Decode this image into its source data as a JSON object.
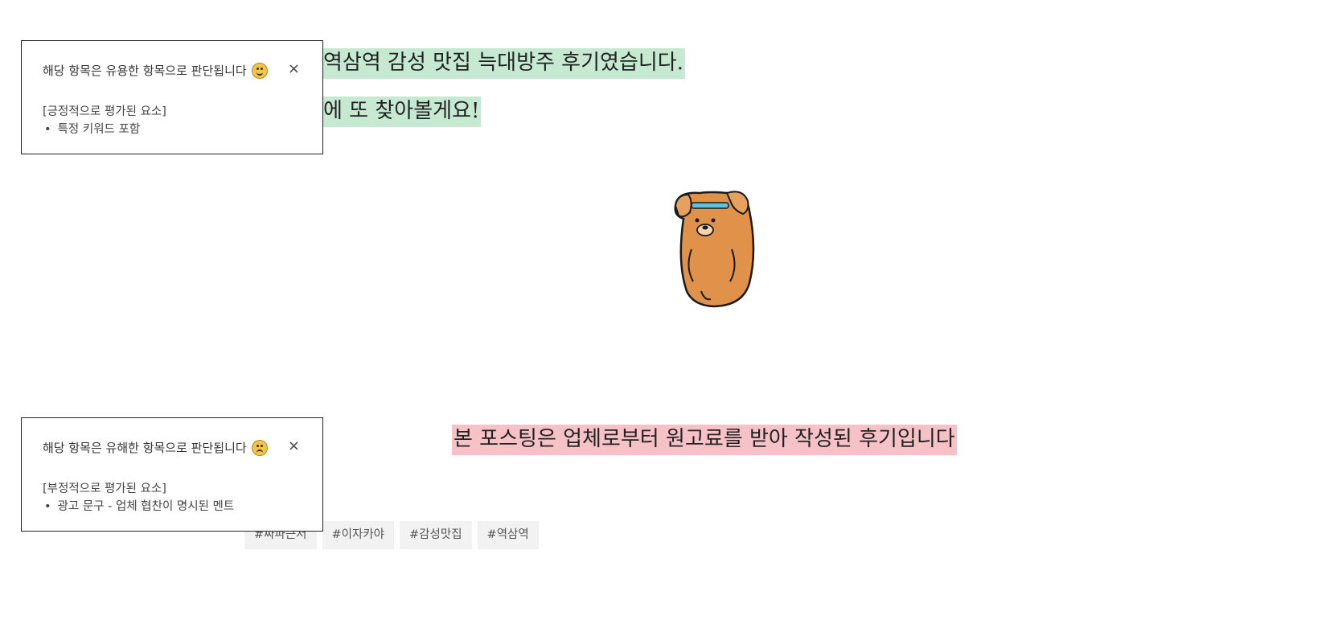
{
  "post": {
    "line1": "역삼역 감성 맛집 늑대방주 후기였습니다.",
    "line2": "에 또 찾아볼게요!",
    "disclosure": "본 포스팅은 업체로부터 원고료를 받아 작성된 후기입니다"
  },
  "popups": [
    {
      "title": "해당 항목은 유용한 항목으로 판단됩니다",
      "emoji": "smile-emoji",
      "close": "×",
      "section": "[긍정적으로 평가된 요소]",
      "items": [
        "특정 키워드 포함"
      ]
    },
    {
      "title": "해당 항목은 유해한 항목으로 판단됩니다",
      "emoji": "confused-emoji",
      "close": "×",
      "section": "[부정적으로 평가된 요소]",
      "items": [
        "광고 문구 - 업체 협찬이 명시된 멘트"
      ]
    }
  ],
  "bullet": "•",
  "tags": [
    "#짜파근저",
    "#이자카야",
    "#감성맛집",
    "#역삼역"
  ],
  "colors": {
    "highlight_green": "#c6ead1",
    "highlight_pink": "#f6c2c7",
    "bear": "#e0914a"
  }
}
